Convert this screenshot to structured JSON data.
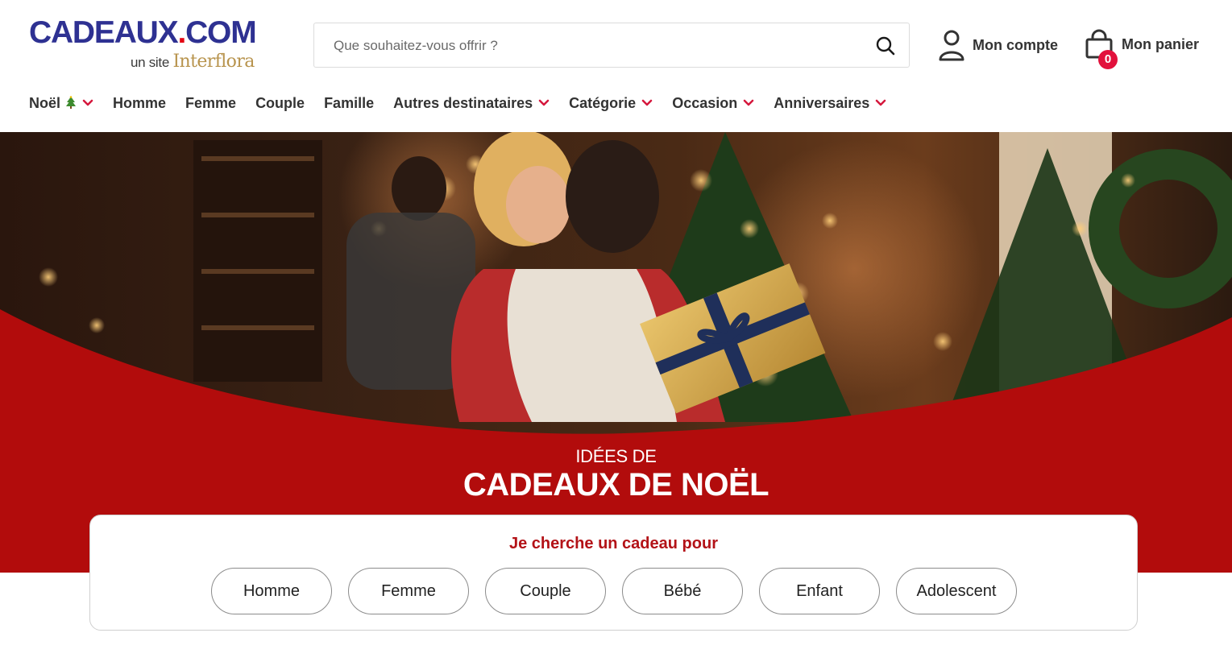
{
  "header": {
    "logo": {
      "main_before_dot": "CADEAUX",
      "dot": ".",
      "main_after_dot": "COM",
      "sub_prefix": "un site",
      "sub_brand": "Interflora"
    },
    "search": {
      "placeholder": "Que souhaitez-vous offrir ?"
    },
    "account_label": "Mon compte",
    "cart": {
      "label": "Mon panier",
      "count": "0"
    }
  },
  "nav": {
    "items": [
      {
        "label": "Noël",
        "has_tree": true,
        "dropdown": true
      },
      {
        "label": "Homme",
        "dropdown": false
      },
      {
        "label": "Femme",
        "dropdown": false
      },
      {
        "label": "Couple",
        "dropdown": false
      },
      {
        "label": "Famille",
        "dropdown": false
      },
      {
        "label": "Autres destinataires",
        "dropdown": true
      },
      {
        "label": "Catégorie",
        "dropdown": true
      },
      {
        "label": "Occasion",
        "dropdown": true
      },
      {
        "label": "Anniversaires",
        "dropdown": true
      }
    ]
  },
  "hero": {
    "title_small": "IDÉES DE",
    "title_big": "CADEAUX DE NOËL"
  },
  "finder": {
    "title": "Je cherche un cadeau pour",
    "options": [
      "Homme",
      "Femme",
      "Couple",
      "Bébé",
      "Enfant",
      "Adolescent"
    ]
  },
  "colors": {
    "brand_blue": "#2e3192",
    "brand_red": "#b20c0c",
    "accent_red": "#e2113c",
    "interflora_gold": "#b8944e"
  },
  "icons": {
    "search": "search-icon",
    "account": "user-icon",
    "cart": "shopping-bag-icon",
    "dropdown": "chevron-down-icon",
    "tree": "christmas-tree-icon"
  }
}
